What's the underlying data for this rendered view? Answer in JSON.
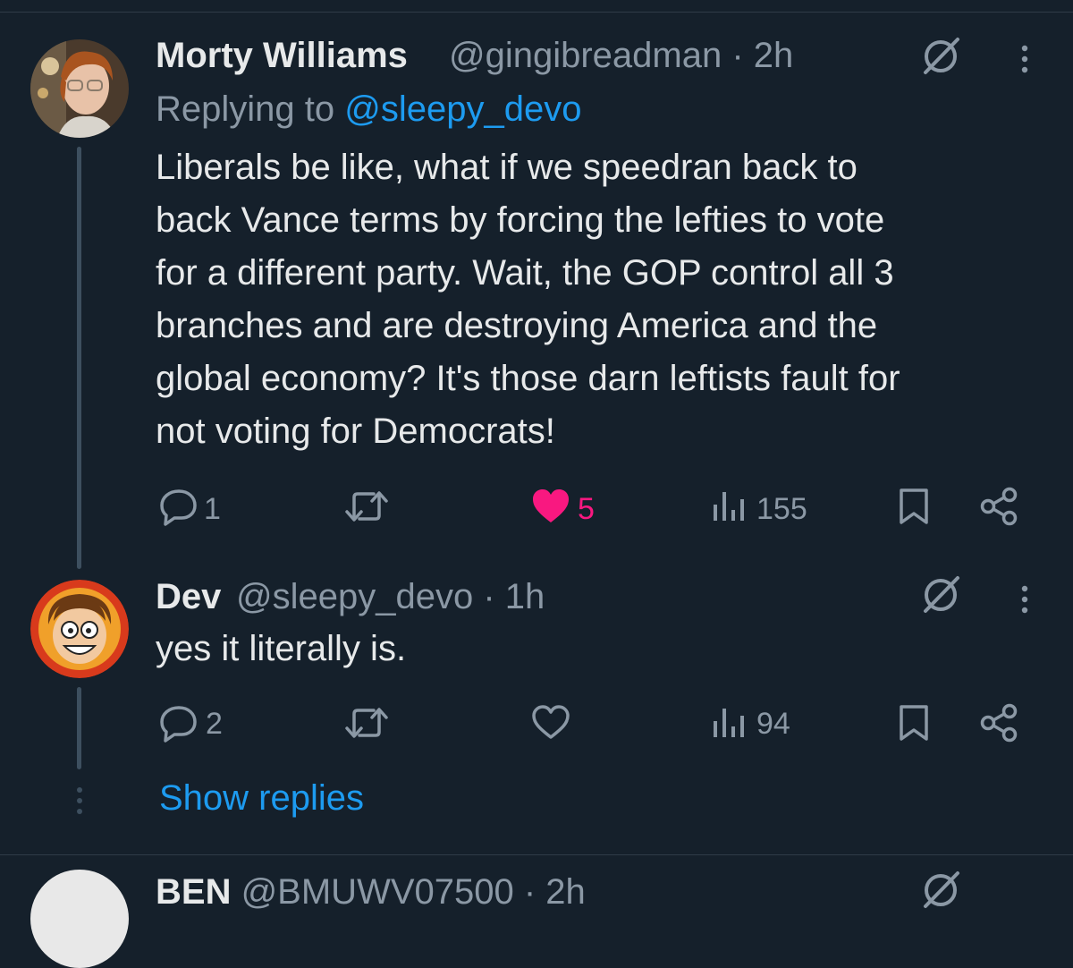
{
  "tweets": [
    {
      "name": "Morty Williams",
      "handle": "@gingibreadman · 2h",
      "replying_prefix": "Replying to ",
      "replying_handle": "@sleepy_devo",
      "text": "Liberals be like, what if we speedran back to\nback Vance terms by forcing the lefties to vote\nfor a different party. Wait, the GOP control all 3\nbranches and are destroying America and the\nglobal economy? It's those darn leftists fault for\nnot voting for Democrats!",
      "replies": "1",
      "likes": "5",
      "views": "155"
    },
    {
      "name": "Dev",
      "handle": "@sleepy_devo · 1h",
      "text": "yes it literally is.",
      "replies": "2",
      "views": "94"
    }
  ],
  "show_replies_label": "Show replies",
  "next_tweet": {
    "name": "BEN",
    "handle": "@BMUWV07500 · 2h"
  },
  "colors": {
    "background": "#15202b",
    "text": "#e7e9ea",
    "secondary": "#8b98a5",
    "link": "#1d9bf0",
    "like": "#f91880"
  }
}
